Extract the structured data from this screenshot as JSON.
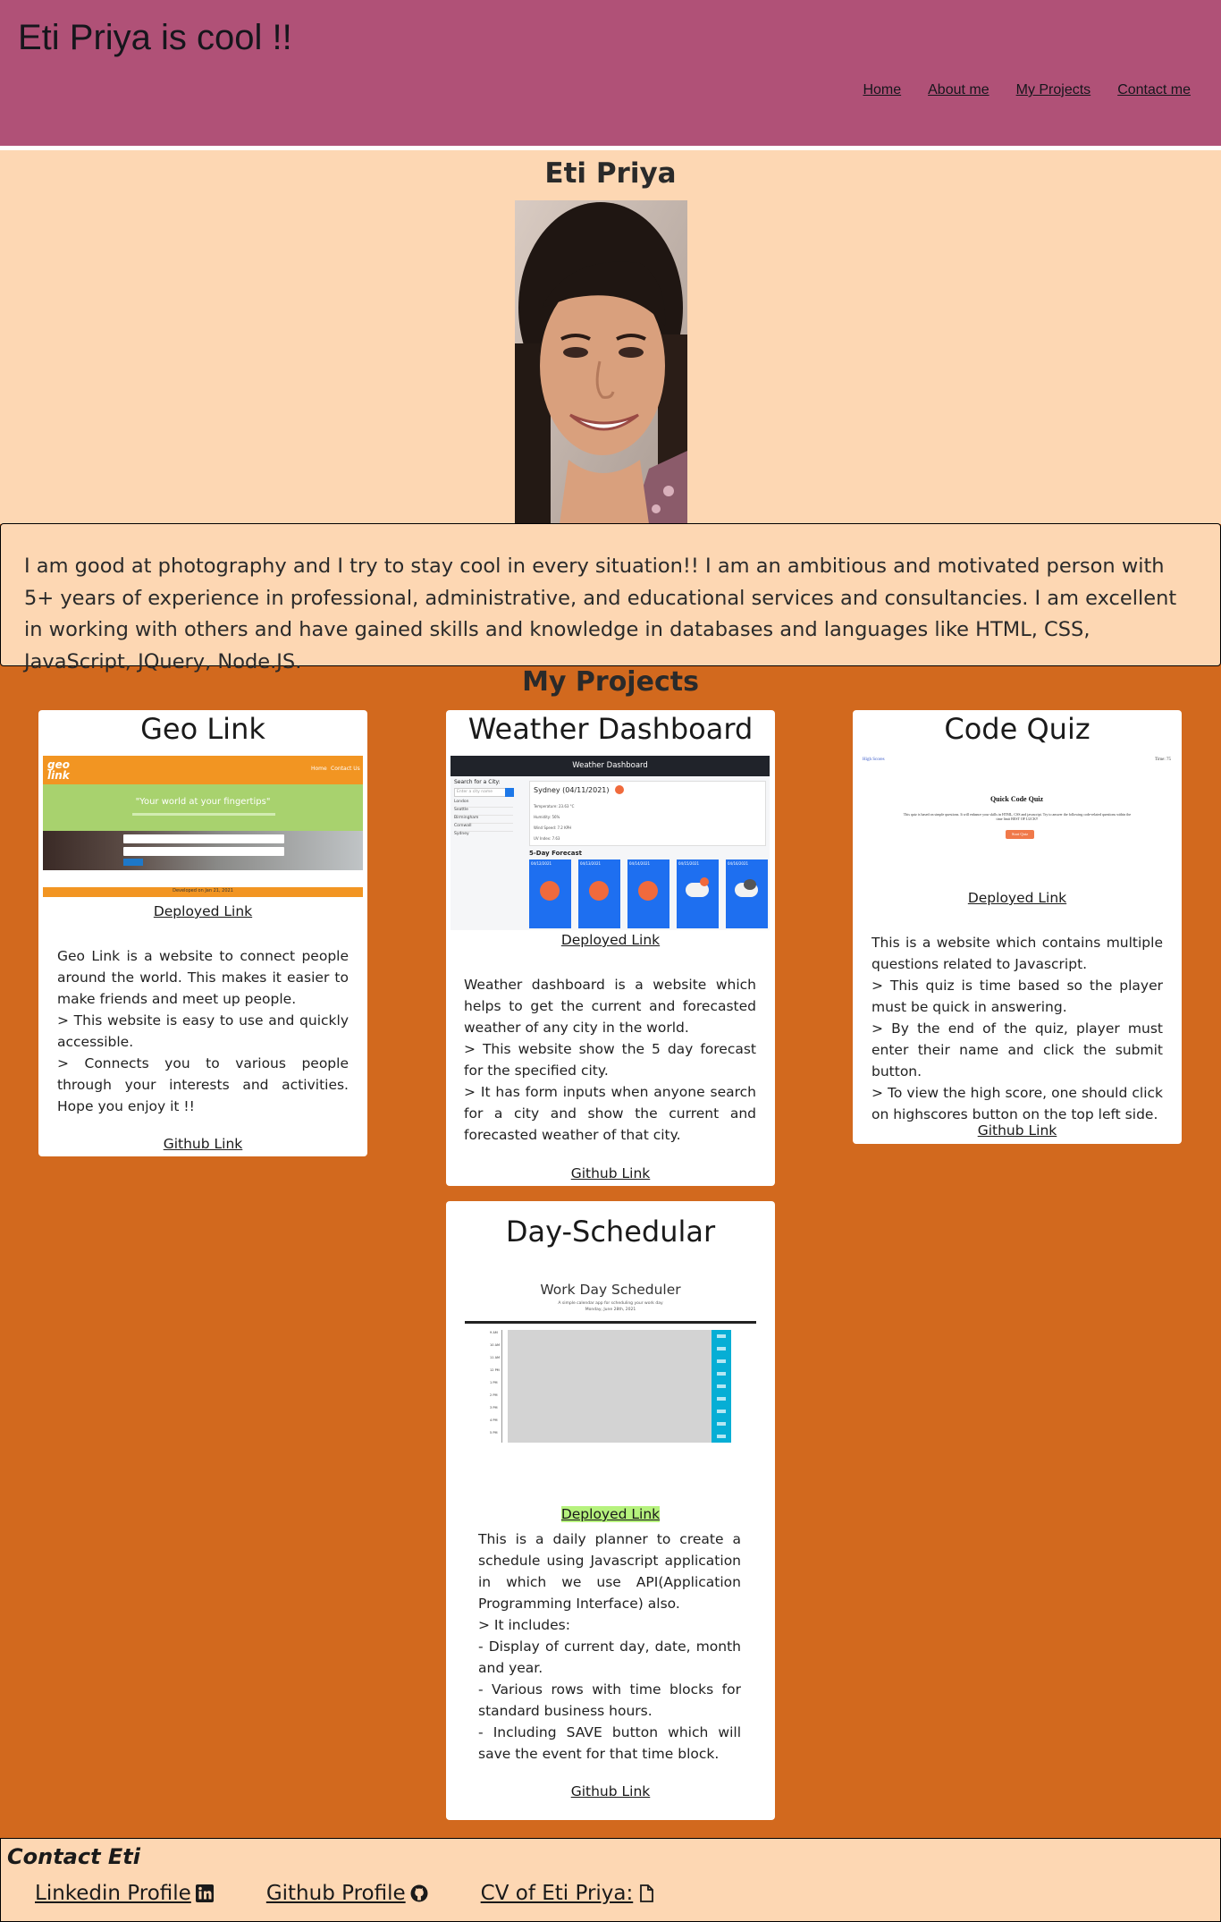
{
  "header": {
    "title": "Eti Priya is cool !!",
    "nav": [
      "Home",
      "About me",
      "My Projects",
      "Contact me"
    ]
  },
  "profile": {
    "name": "Eti Priya",
    "bio": "I am good at photography and I try to stay cool in every situation!! I am an ambitious and motivated person with 5+ years of experience in professional, administrative, and educational services and consultancies. I am excellent in working with others and have gained skills and knowledge in databases and languages like HTML, CSS, JavaScript, JQuery, Node.JS."
  },
  "projects": {
    "title": "My Projects",
    "items": [
      {
        "title": "Geo Link",
        "deployed": "Deployed Link",
        "github": "Github Link",
        "desc": [
          "Geo Link is a website to connect people around the world. This makes it easier to make friends and meet up people.",
          "> This website is easy to use and quickly accessible.",
          "> Connects you to various people through your interests and activities. Hope you enjoy it !!"
        ],
        "screenshot": {
          "logo": "geo link",
          "nav": [
            "Home",
            "Contact Us"
          ],
          "tagline": "\"Your world at your fingertips\"",
          "footer": "Developed on Jan 21, 2021"
        }
      },
      {
        "title": "Weather Dashboard",
        "deployed": "Deployed Link",
        "github": "Github Link",
        "desc": [
          "Weather dashboard is a website which helps to get the current and forecasted weather of any city in the world.",
          "> This website show the 5 day forecast for the specified city.",
          "> It has form inputs when anyone search for a city and show the current and forecasted weather of that city."
        ],
        "screenshot": {
          "header": "Weather Dashboard",
          "search_label": "Search for a City:",
          "search_placeholder": "Enter a city name",
          "cities": [
            "London",
            "Seattle",
            "Birmingham",
            "Cornwall",
            "Sydney"
          ],
          "current_city": "Sydney (04/11/2021)",
          "current_lines": [
            "Temperature: 23.63 °C",
            "Humidity: 56%",
            "Wind Speed: 7.2 KPH",
            "UV Index: 7.63"
          ],
          "forecast_title": "5-Day Forecast",
          "forecast_dates": [
            "04/12/2021",
            "04/13/2021",
            "04/14/2021",
            "04/15/2021",
            "04/16/2021"
          ]
        }
      },
      {
        "title": "Code Quiz",
        "deployed": "Deployed Link",
        "github": "Github Link",
        "desc": [
          "This is a website which contains multiple questions related to Javascript.",
          "> This quiz is time based so the player must be quick in answering.",
          "> By the end of the quiz, player must enter their name and click the submit button.",
          "> To view the high score, one should click on highscores button on the top left side."
        ],
        "screenshot": {
          "left": "High Scores",
          "right": "Time: 75",
          "heading": "Quick Code Quiz",
          "body": "This quiz is based on simple questions. It will enhance your skills in HTML, CSS and javascript. Try to answer the following code-related questions within the time limit BEST OF LUCK!!",
          "button": "Start Quiz"
        }
      },
      {
        "title": "Day-Schedular",
        "deployed": "Deployed Link",
        "github": "Github Link",
        "desc": [
          "This is a daily planner to create a schedule using Javascript application in which we use API(Application Programming Interface) also.",
          "> It includes:",
          "- Display of current day, date, month and year.",
          "- Various rows with time blocks for standard business hours.",
          "- Including SAVE button which will save the event for that time block."
        ],
        "screenshot": {
          "heading": "Work Day Scheduler",
          "subheading": "A simple calendar app for scheduling your work day",
          "date": "Monday, June 28th, 2021",
          "hours": [
            "9 AM",
            "10 AM",
            "11 AM",
            "12 PM",
            "1 PM",
            "2 PM",
            "3 PM",
            "4 PM",
            "5 PM"
          ]
        }
      }
    ]
  },
  "footer": {
    "title": "Contact Eti",
    "links": [
      "Linkedin Profile",
      "Github Profile",
      "CV of Eti Priya:"
    ]
  },
  "colors": {
    "header": "#b05177",
    "peach": "#fdd7b3",
    "orange": "#d2691e"
  }
}
